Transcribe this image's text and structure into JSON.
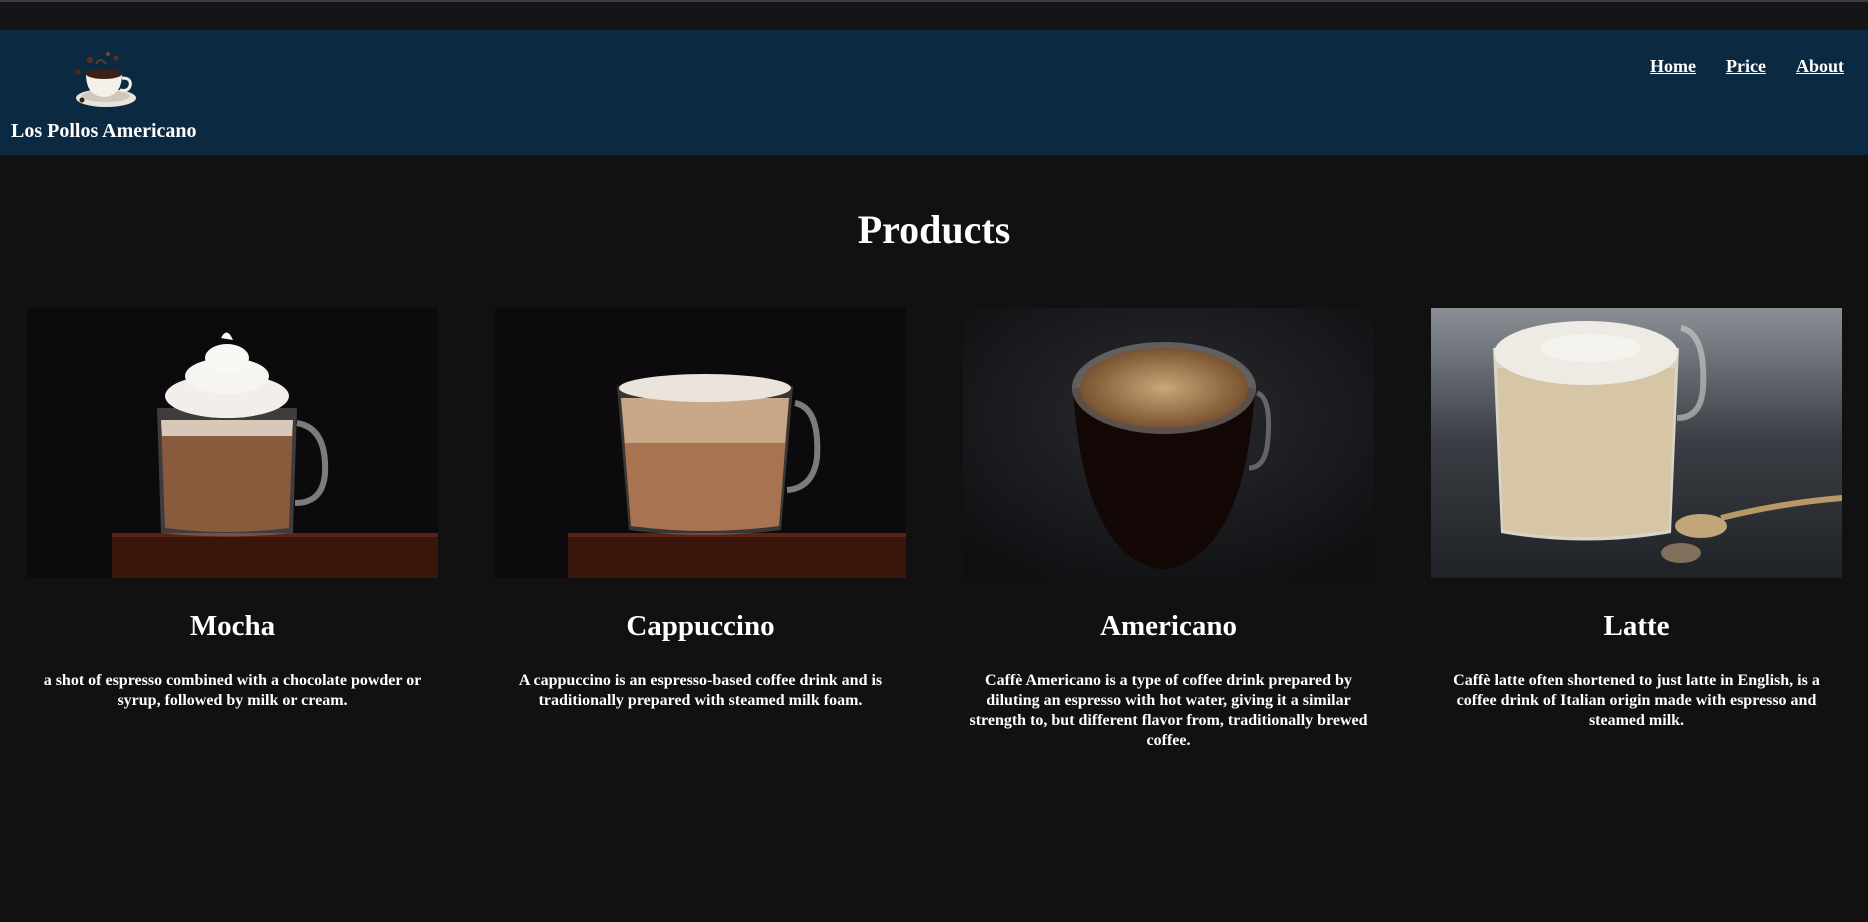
{
  "brand": {
    "name": "Los Pollos Americano",
    "logo_icon": "coffee-cup-icon"
  },
  "nav": {
    "items": [
      "Home",
      "Price",
      "About"
    ]
  },
  "page": {
    "title": "Products"
  },
  "products": [
    {
      "name": "Mocha",
      "description": "a shot of espresso combined with a chocolate powder or syrup, followed by milk or cream.",
      "image": "mocha-mug-image"
    },
    {
      "name": "Cappuccino",
      "description": "A cappuccino is an espresso-based coffee drink and is traditionally prepared with steamed milk foam.",
      "image": "cappuccino-mug-image"
    },
    {
      "name": "Americano",
      "description": "Caffè Americano is a type of coffee drink prepared by diluting an espresso with hot water, giving it a similar strength to, but different flavor from, traditionally brewed coffee.",
      "image": "americano-mug-image"
    },
    {
      "name": "Latte",
      "description": "Caffè latte often shortened to just latte in English, is a coffee drink of Italian origin made with espresso and steamed milk.",
      "image": "latte-mug-image"
    }
  ],
  "colors": {
    "background": "#111111",
    "header": "#0b2940",
    "text": "#ffffff"
  }
}
